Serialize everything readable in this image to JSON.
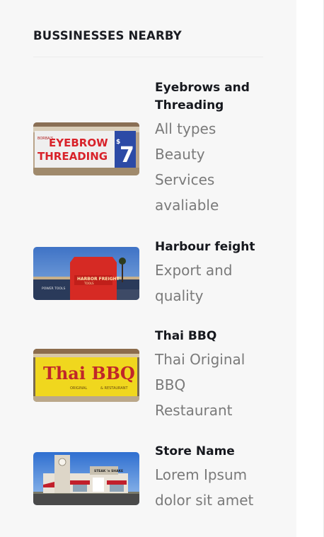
{
  "widget": {
    "title": "BUSSINESSES NEARBY"
  },
  "businesses": [
    {
      "name": "Eyebrows and Threading",
      "description": "All types Beauty Services avaliable",
      "image_text": {
        "small": "BORBA'S",
        "line1": "EYEBROW",
        "line2": "THREADING",
        "price": "7",
        "currency": "$"
      }
    },
    {
      "name": "Harbour feight",
      "description": "Export and quality",
      "image_text": {
        "sign": "HARBOR FREIGHT",
        "sub": "TOOLS",
        "left": "POWER TOOLS"
      }
    },
    {
      "name": "Thai BBQ",
      "description": "Thai Original BBQ Restaurant",
      "image_text": {
        "main": "Thai BBQ",
        "sub1": "ORIGINAL",
        "sub2": "& RESTAURANT"
      }
    },
    {
      "name": "Store Name",
      "description": "Lorem Ipsum dolor sit amet",
      "image_text": {
        "sign": "STEAK 'n SHAKE"
      }
    }
  ],
  "colors": {
    "sidebar_bg": "#f7f7f7",
    "title": "#1a1c22",
    "description": "#7a7a7a"
  }
}
